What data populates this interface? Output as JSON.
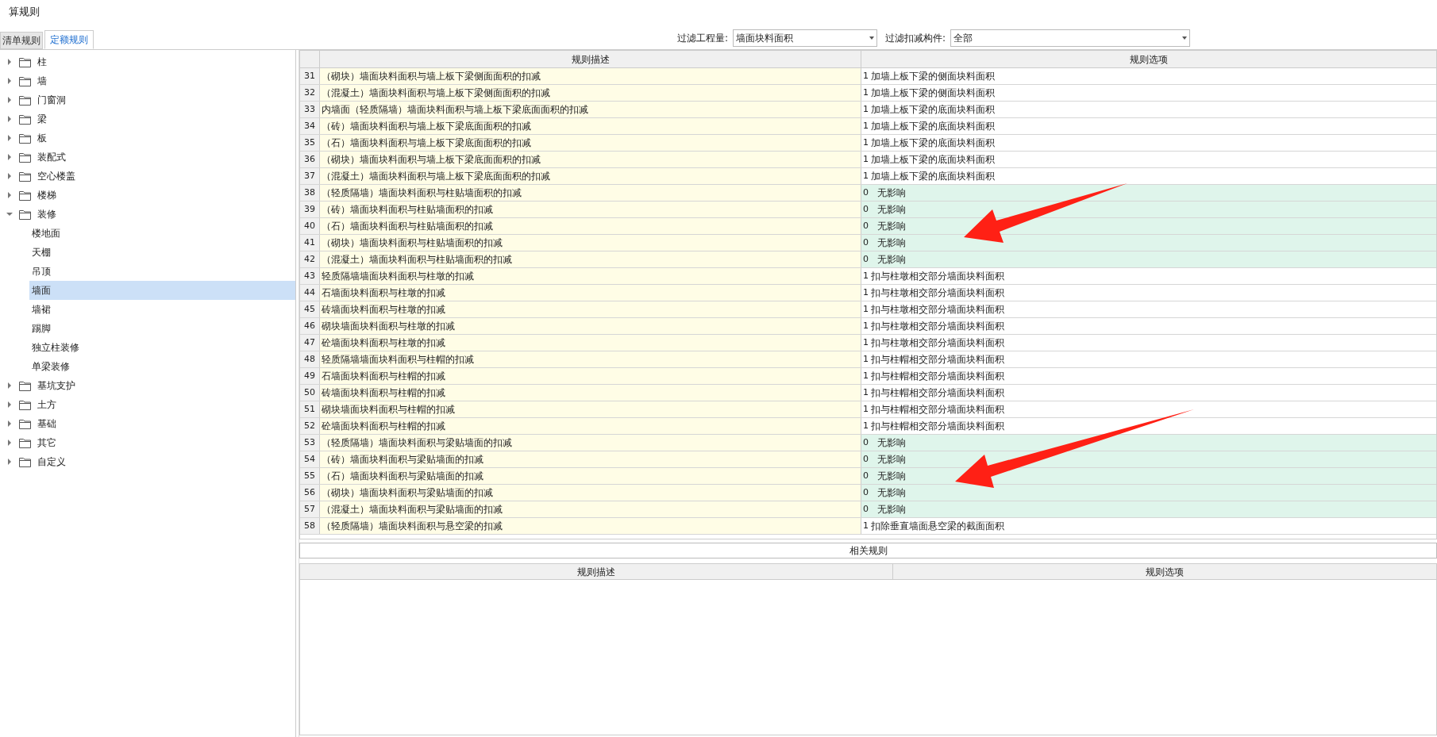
{
  "window": {
    "title": "算规则"
  },
  "tabs": [
    {
      "label": "清单规则",
      "selected": false
    },
    {
      "label": "定额规则",
      "selected": true
    }
  ],
  "filters": [
    {
      "label": "过滤工程量:",
      "value": "墙面块料面积"
    },
    {
      "label": "过滤扣减构件:",
      "value": "全部"
    }
  ],
  "tree": [
    {
      "label": "柱",
      "expanded": false
    },
    {
      "label": "墙",
      "expanded": false
    },
    {
      "label": "门窗洞",
      "expanded": false
    },
    {
      "label": "梁",
      "expanded": false
    },
    {
      "label": "板",
      "expanded": false
    },
    {
      "label": "装配式",
      "expanded": false
    },
    {
      "label": "空心楼盖",
      "expanded": false
    },
    {
      "label": "楼梯",
      "expanded": false
    },
    {
      "label": "装修",
      "expanded": true,
      "children": [
        {
          "label": "楼地面",
          "selected": false
        },
        {
          "label": "天棚",
          "selected": false
        },
        {
          "label": "吊顶",
          "selected": false
        },
        {
          "label": "墙面",
          "selected": true
        },
        {
          "label": "墙裙",
          "selected": false
        },
        {
          "label": "踢脚",
          "selected": false
        },
        {
          "label": "独立柱装修",
          "selected": false
        },
        {
          "label": "单梁装修",
          "selected": false
        }
      ]
    },
    {
      "label": "基坑支护",
      "expanded": false
    },
    {
      "label": "土方",
      "expanded": false
    },
    {
      "label": "基础",
      "expanded": false
    },
    {
      "label": "其它",
      "expanded": false
    },
    {
      "label": "自定义",
      "expanded": false
    }
  ],
  "rules_table": {
    "columns": [
      "规则描述",
      "规则选项"
    ],
    "rows": [
      {
        "number": "31",
        "description": "（砌块）墙面块料面积与墙上板下梁侧面面积的扣减",
        "option_value": "1",
        "option_text": "加墙上板下梁的侧面块料面积",
        "highlighted": false
      },
      {
        "number": "32",
        "description": "（混凝土）墙面块料面积与墙上板下梁侧面面积的扣减",
        "option_value": "1",
        "option_text": "加墙上板下梁的侧面块料面积",
        "highlighted": false
      },
      {
        "number": "33",
        "description": "内墙面（轻质隔墙）墙面块料面积与墙上板下梁底面面积的扣减",
        "option_value": "1",
        "option_text": "加墙上板下梁的底面块料面积",
        "highlighted": false
      },
      {
        "number": "34",
        "description": "（砖）墙面块料面积与墙上板下梁底面面积的扣减",
        "option_value": "1",
        "option_text": "加墙上板下梁的底面块料面积",
        "highlighted": false
      },
      {
        "number": "35",
        "description": "（石）墙面块料面积与墙上板下梁底面面积的扣减",
        "option_value": "1",
        "option_text": "加墙上板下梁的底面块料面积",
        "highlighted": false
      },
      {
        "number": "36",
        "description": "（砌块）墙面块料面积与墙上板下梁底面面积的扣减",
        "option_value": "1",
        "option_text": "加墙上板下梁的底面块料面积",
        "highlighted": false
      },
      {
        "number": "37",
        "description": "（混凝土）墙面块料面积与墙上板下梁底面面积的扣减",
        "option_value": "1",
        "option_text": "加墙上板下梁的底面块料面积",
        "highlighted": false
      },
      {
        "number": "38",
        "description": "（轻质隔墙）墙面块料面积与柱贴墙面积的扣减",
        "option_value": "0",
        "option_text": "无影响",
        "highlighted": true
      },
      {
        "number": "39",
        "description": "（砖）墙面块料面积与柱贴墙面积的扣减",
        "option_value": "0",
        "option_text": "无影响",
        "highlighted": true
      },
      {
        "number": "40",
        "description": "（石）墙面块料面积与柱贴墙面积的扣减",
        "option_value": "0",
        "option_text": "无影响",
        "highlighted": true
      },
      {
        "number": "41",
        "description": "（砌块）墙面块料面积与柱贴墙面积的扣减",
        "option_value": "0",
        "option_text": "无影响",
        "highlighted": true
      },
      {
        "number": "42",
        "description": "（混凝土）墙面块料面积与柱贴墙面积的扣减",
        "option_value": "0",
        "option_text": "无影响",
        "highlighted": true
      },
      {
        "number": "43",
        "description": "轻质隔墙墙面块料面积与柱墩的扣减",
        "option_value": "1",
        "option_text": "扣与柱墩相交部分墙面块料面积",
        "highlighted": false
      },
      {
        "number": "44",
        "description": "石墙面块料面积与柱墩的扣减",
        "option_value": "1",
        "option_text": "扣与柱墩相交部分墙面块料面积",
        "highlighted": false
      },
      {
        "number": "45",
        "description": "砖墙面块料面积与柱墩的扣减",
        "option_value": "1",
        "option_text": "扣与柱墩相交部分墙面块料面积",
        "highlighted": false
      },
      {
        "number": "46",
        "description": "砌块墙面块料面积与柱墩的扣减",
        "option_value": "1",
        "option_text": "扣与柱墩相交部分墙面块料面积",
        "highlighted": false
      },
      {
        "number": "47",
        "description": "砼墙面块料面积与柱墩的扣减",
        "option_value": "1",
        "option_text": "扣与柱墩相交部分墙面块料面积",
        "highlighted": false
      },
      {
        "number": "48",
        "description": "轻质隔墙墙面块料面积与柱帽的扣减",
        "option_value": "1",
        "option_text": "扣与柱帽相交部分墙面块料面积",
        "highlighted": false
      },
      {
        "number": "49",
        "description": "石墙面块料面积与柱帽的扣减",
        "option_value": "1",
        "option_text": "扣与柱帽相交部分墙面块料面积",
        "highlighted": false
      },
      {
        "number": "50",
        "description": "砖墙面块料面积与柱帽的扣减",
        "option_value": "1",
        "option_text": "扣与柱帽相交部分墙面块料面积",
        "highlighted": false
      },
      {
        "number": "51",
        "description": "砌块墙面块料面积与柱帽的扣减",
        "option_value": "1",
        "option_text": "扣与柱帽相交部分墙面块料面积",
        "highlighted": false
      },
      {
        "number": "52",
        "description": "砼墙面块料面积与柱帽的扣减",
        "option_value": "1",
        "option_text": "扣与柱帽相交部分墙面块料面积",
        "highlighted": false
      },
      {
        "number": "53",
        "description": "（轻质隔墙）墙面块料面积与梁贴墙面的扣减",
        "option_value": "0",
        "option_text": "无影响",
        "highlighted": true
      },
      {
        "number": "54",
        "description": "（砖）墙面块料面积与梁贴墙面的扣减",
        "option_value": "0",
        "option_text": "无影响",
        "highlighted": true
      },
      {
        "number": "55",
        "description": "（石）墙面块料面积与梁贴墙面的扣减",
        "option_value": "0",
        "option_text": "无影响",
        "highlighted": true
      },
      {
        "number": "56",
        "description": "（砌块）墙面块料面积与梁贴墙面的扣减",
        "option_value": "0",
        "option_text": "无影响",
        "highlighted": true
      },
      {
        "number": "57",
        "description": "（混凝土）墙面块料面积与梁贴墙面的扣减",
        "option_value": "0",
        "option_text": "无影响",
        "highlighted": true
      },
      {
        "number": "58",
        "description": "（轻质隔墙）墙面块料面积与悬空梁的扣减",
        "option_value": "1",
        "option_text": "扣除垂直墙面悬空梁的截面面积",
        "highlighted": false
      }
    ]
  },
  "related": {
    "title": "相关规则",
    "columns": [
      "规则描述",
      "规则选项"
    ]
  }
}
